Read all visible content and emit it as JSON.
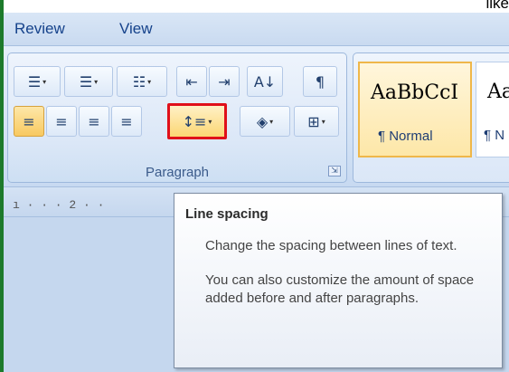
{
  "top_text": "like",
  "tabs": [
    {
      "label": "Review"
    },
    {
      "label": "View"
    }
  ],
  "paragraph_group": {
    "label": "Paragraph",
    "launcher_glyph": "⇲",
    "row1": [
      {
        "name": "bullets",
        "glyph": "☰",
        "caret": "▾"
      },
      {
        "name": "numbering",
        "glyph": "☰",
        "caret": "▾"
      },
      {
        "name": "multilevel-list",
        "glyph": "☷",
        "caret": "▾"
      },
      {
        "name": "decrease-indent",
        "glyph": "⇤"
      },
      {
        "name": "increase-indent",
        "glyph": "⇥"
      },
      {
        "name": "sort",
        "glyph": "A↓"
      },
      {
        "name": "show-hide",
        "glyph": "¶"
      }
    ],
    "row2": [
      {
        "name": "align-left",
        "glyph": "≡"
      },
      {
        "name": "center",
        "glyph": "≡"
      },
      {
        "name": "align-right",
        "glyph": "≡"
      },
      {
        "name": "justify",
        "glyph": "≡"
      },
      {
        "name": "line-spacing",
        "glyph": "↕≡",
        "caret": "▾"
      },
      {
        "name": "shading",
        "glyph": "◈",
        "caret": "▾"
      },
      {
        "name": "borders",
        "glyph": "⊞",
        "caret": "▾"
      }
    ]
  },
  "styles": [
    {
      "sample": "AaBbCcI",
      "name": "¶ Normal"
    },
    {
      "sample": "Aa",
      "name": "¶ N"
    }
  ],
  "ruler": {
    "marks": "ı · · · 2 · ·"
  },
  "tooltip": {
    "title": "Line spacing",
    "text1": "Change the spacing between lines of text.",
    "text2": "You can also customize the amount of space added before and after paragraphs."
  },
  "colors": {
    "ribbon_blue": "#c5d7ee",
    "tab_text": "#15428b",
    "highlight_red": "#e0101a",
    "active_gold": "#f8c960",
    "left_edge_green": "#1d7a2b"
  }
}
